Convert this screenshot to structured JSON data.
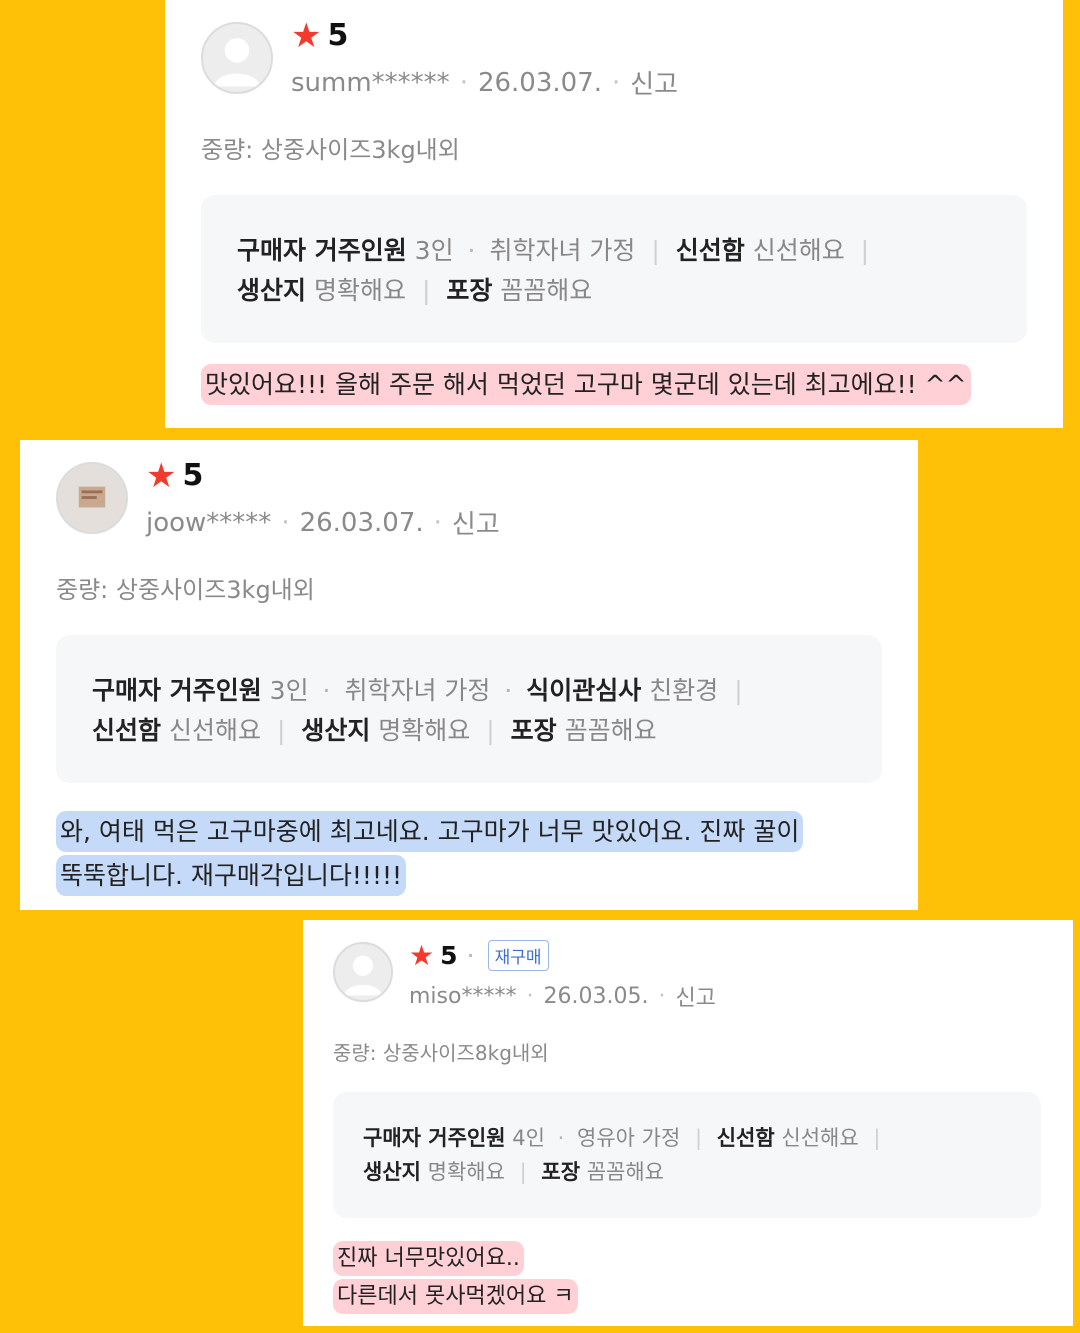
{
  "colors": {
    "background": "#ffc107",
    "star": "#f23a2e",
    "highlight_pink": "#ffb3bd",
    "highlight_blue": "#b0cdf5",
    "rebuy_badge": "#3c6fd0"
  },
  "reviews": [
    {
      "star_icon": "★",
      "rating": "5",
      "user": "summ******",
      "date": "26.03.07.",
      "report": "신고",
      "weight": "중량: 상중사이즈3kg내외",
      "attr_line1": [
        {
          "label": "구매자 거주인원",
          "value": "3인"
        },
        {
          "value": "취학자녀 가정"
        },
        {
          "label": "신선함",
          "value": "신선해요"
        }
      ],
      "attr_line2": [
        {
          "label": "생산지",
          "value": "명확해요"
        },
        {
          "label": "포장",
          "value": "꼼꼼해요"
        }
      ],
      "text": [
        "맛있어요!!! 올해 주문 해서 먹었던 고구마 몇군데 있는데 최고에요!! ^^"
      ]
    },
    {
      "star_icon": "★",
      "rating": "5",
      "user": "joow*****",
      "date": "26.03.07.",
      "report": "신고",
      "weight": "중량: 상중사이즈3kg내외",
      "attr_line1": [
        {
          "label": "구매자 거주인원",
          "value": "3인"
        },
        {
          "value": "취학자녀 가정"
        },
        {
          "label": "식이관심사",
          "value": "친환경"
        }
      ],
      "attr_line2": [
        {
          "label": "신선함",
          "value": "신선해요"
        },
        {
          "label": "생산지",
          "value": "명확해요"
        },
        {
          "label": "포장",
          "value": "꼼꼼해요"
        }
      ],
      "text": [
        "와, 여태 먹은 고구마중에 최고네요. 고구마가 너무 맛있어요. 진짜 꿀이",
        "뚝뚝합니다. 재구매각입니다!!!!!"
      ]
    },
    {
      "star_icon": "★",
      "rating": "5",
      "badge": "재구매",
      "user": "miso*****",
      "date": "26.03.05.",
      "report": "신고",
      "weight": "중량: 상중사이즈8kg내외",
      "attr_line1": [
        {
          "label": "구매자 거주인원",
          "value": "4인"
        },
        {
          "value": "영유아 가정"
        },
        {
          "label": "신선함",
          "value": "신선해요"
        }
      ],
      "attr_line2": [
        {
          "label": "생산지",
          "value": "명확해요"
        },
        {
          "label": "포장",
          "value": "꼼꼼해요"
        }
      ],
      "text": [
        "진짜 너무맛있어요..",
        "다른데서 못사먹겠어요 ㅋ"
      ]
    }
  ]
}
